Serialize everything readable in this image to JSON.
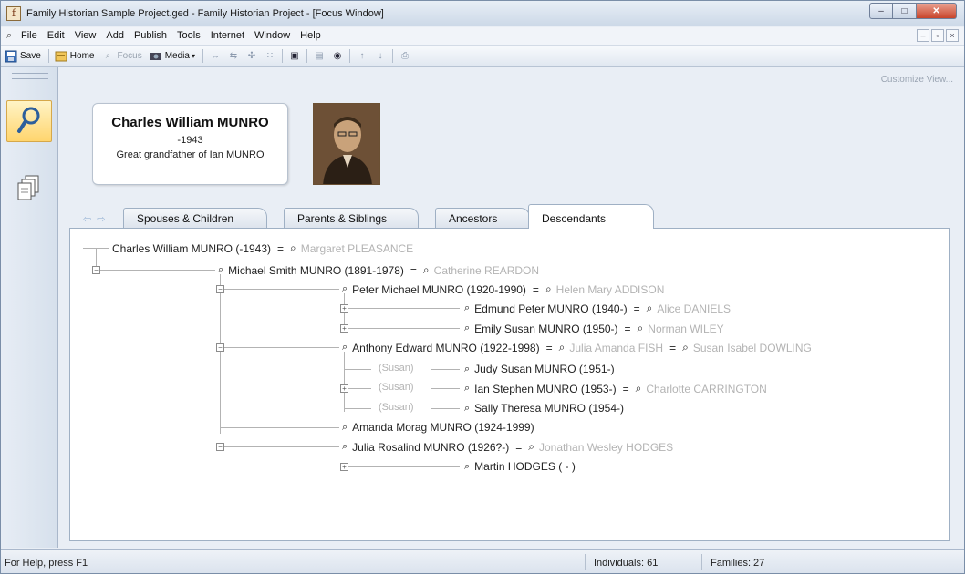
{
  "window": {
    "title": "Family Historian Sample Project.ged - Family Historian Project - [Focus Window]",
    "app_icon_glyph": "f",
    "minimize_label": "–",
    "maximize_label": "□",
    "close_label": "✕"
  },
  "menubar": {
    "items": [
      "File",
      "Edit",
      "View",
      "Add",
      "Publish",
      "Tools",
      "Internet",
      "Window",
      "Help"
    ],
    "mdi": [
      "–",
      "▫",
      "×"
    ]
  },
  "toolbar": {
    "save_label": "Save",
    "home_label": "Home",
    "focus_label": "Focus",
    "media_label": "Media",
    "icons": [
      "tree-wide-icon",
      "tree-narrow-icon",
      "expand-icon",
      "collapse-icon",
      "screen-icon",
      "properties-icon",
      "find-icon",
      "up-arrow-icon",
      "down-arrow-icon",
      "print-icon"
    ]
  },
  "sidebar": {
    "buttons": [
      "focus-view-icon",
      "records-icon"
    ]
  },
  "focus": {
    "customize_label": "Customize View...",
    "name": "Charles William MUNRO",
    "dates": "-1943",
    "relationship": "Great grandfather of Ian MUNRO"
  },
  "tabs": [
    {
      "label": "Spouses & Children",
      "active": false
    },
    {
      "label": "Parents & Siblings",
      "active": false
    },
    {
      "label": "Ancestors",
      "active": false
    },
    {
      "label": "Descendants",
      "active": true
    }
  ],
  "tree": {
    "root": {
      "name": "Charles William MUNRO (-1943)",
      "spouse": "Margaret PLEASANCE"
    },
    "n1": {
      "name": "Michael Smith MUNRO (1891-1978)",
      "spouse": "Catherine REARDON"
    },
    "n2": {
      "name": "Peter Michael MUNRO (1920-1990)",
      "spouse": "Helen Mary ADDISON"
    },
    "n3": {
      "name": "Edmund Peter MUNRO (1940-)",
      "spouse": "Alice DANIELS"
    },
    "n4": {
      "name": "Emily Susan MUNRO (1950-)",
      "spouse": "Norman WILEY"
    },
    "n5": {
      "name": "Anthony Edward MUNRO (1922-1998)",
      "spouse": "Julia Amanda FISH",
      "spouse2": "Susan Isabel DOWLING"
    },
    "n6": {
      "name": "Judy Susan MUNRO (1951-)",
      "mother": "(Susan)"
    },
    "n7": {
      "name": "Ian Stephen MUNRO (1953-)",
      "mother": "(Susan)",
      "spouse": "Charlotte CARRINGTON"
    },
    "n8": {
      "name": "Sally Theresa MUNRO (1954-)",
      "mother": "(Susan)"
    },
    "n9": {
      "name": "Amanda Morag MUNRO (1924-1999)"
    },
    "n10": {
      "name": "Julia Rosalind MUNRO (1926?-)",
      "spouse": "Jonathan Wesley HODGES"
    },
    "n11": {
      "name": "Martin HODGES ( - )"
    }
  },
  "status": {
    "help": "For Help, press F1",
    "individuals": "Individuals: 61",
    "families": "Families: 27"
  }
}
